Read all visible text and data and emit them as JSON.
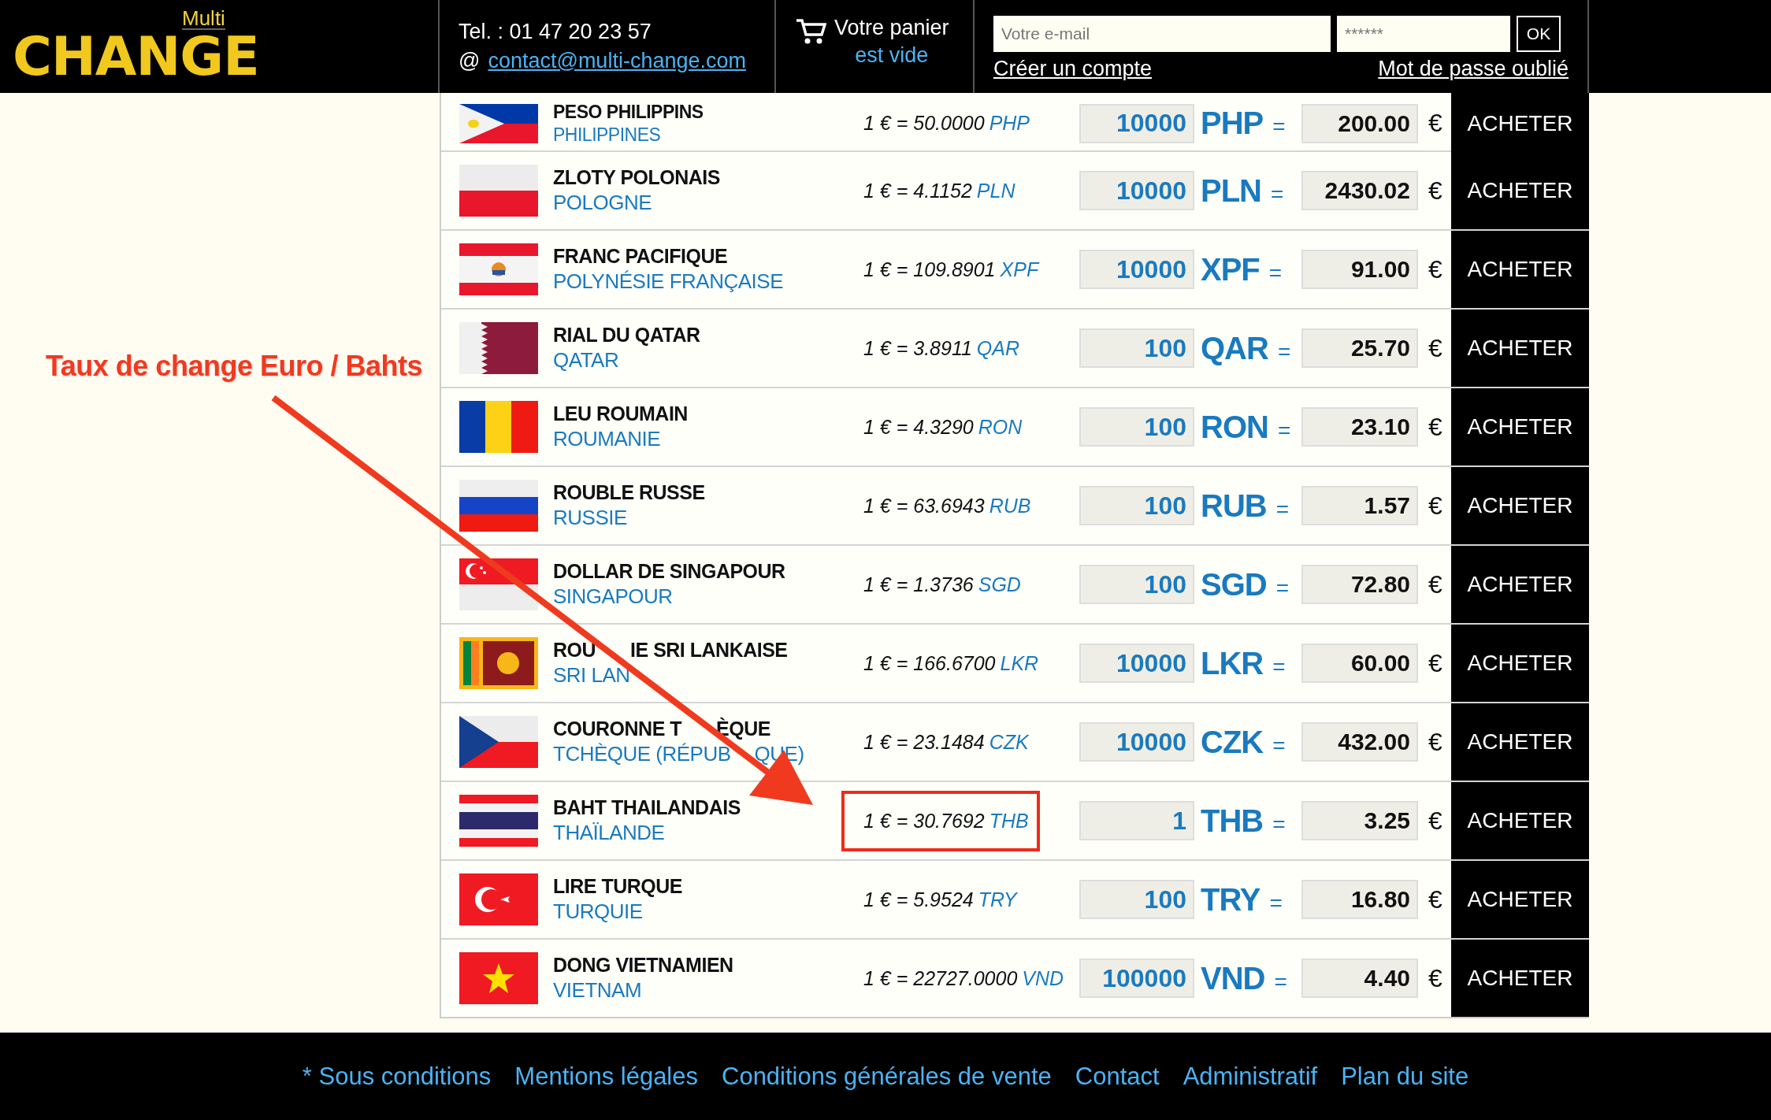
{
  "header": {
    "logo": {
      "small": "Multi",
      "big": "CHANGE"
    },
    "phone": "Tel. : 01 47 20 23 57",
    "at_sign": "@",
    "email_link": "contact@multi-change.com",
    "cart": {
      "title": "Votre panier",
      "status": "est vide"
    },
    "login": {
      "email_placeholder": "Votre e-mail",
      "password_placeholder": "******",
      "ok_button": "OK",
      "create_account": "Créer un compte",
      "forgot_password": "Mot de passe oublié"
    }
  },
  "annotation": {
    "label": "Taux de change Euro / Bahts"
  },
  "rates": [
    {
      "currency": [
        "PESO PHILIPPINS"
      ],
      "country": [
        "PHILIPPINES"
      ],
      "rate": "1 € = 50.0000",
      "rate_code": "PHP",
      "amount": "10000",
      "code": "PHP",
      "sign": "=",
      "price": "200.00",
      "euro": "€",
      "button": "ACHETER",
      "highlighted": false
    },
    {
      "currency": [
        "ZLOTY POLONAIS"
      ],
      "country": [
        "POLOGNE"
      ],
      "rate": "1 € = 4.1152",
      "rate_code": "PLN",
      "amount": "10000",
      "code": "PLN",
      "sign": "=",
      "price": "2430.02",
      "euro": "€",
      "button": "ACHETER",
      "highlighted": false
    },
    {
      "currency": [
        "FRANC PACIFIQUE"
      ],
      "country": [
        "POLYNÉSIE FRANÇAISE"
      ],
      "rate": "1 € = 109.8901",
      "rate_code": "XPF",
      "amount": "10000",
      "code": "XPF",
      "sign": "=",
      "price": "91.00",
      "euro": "€",
      "button": "ACHETER",
      "highlighted": false
    },
    {
      "currency": [
        "RIAL DU QATAR"
      ],
      "country": [
        "QATAR"
      ],
      "rate": "1 € = 3.8911",
      "rate_code": "QAR",
      "amount": "100",
      "code": "QAR",
      "sign": "=",
      "price": "25.70",
      "euro": "€",
      "button": "ACHETER",
      "highlighted": false
    },
    {
      "currency": [
        "LEU ROUMAIN"
      ],
      "country": [
        "ROUMANIE"
      ],
      "rate": "1 € = 4.3290",
      "rate_code": "RON",
      "amount": "100",
      "code": "RON",
      "sign": "=",
      "price": "23.10",
      "euro": "€",
      "button": "ACHETER",
      "highlighted": false
    },
    {
      "currency": [
        "ROUBLE RUSSE"
      ],
      "country": [
        "RUSSIE"
      ],
      "rate": "1 € = 63.6943",
      "rate_code": "RUB",
      "amount": "100",
      "code": "RUB",
      "sign": "=",
      "price": "1.57",
      "euro": "€",
      "button": "ACHETER",
      "highlighted": false
    },
    {
      "currency": [
        "DOLLAR DE SINGAPOUR"
      ],
      "country": [
        "SINGAPOUR"
      ],
      "rate": "1 € = 1.3736",
      "rate_code": "SGD",
      "amount": "100",
      "code": "SGD",
      "sign": "=",
      "price": "72.80",
      "euro": "€",
      "button": "ACHETER",
      "highlighted": false
    },
    {
      "currency": [
        "ROU",
        "IE SRI LANKAISE"
      ],
      "country": [
        "SRI LAN"
      ],
      "rate": "1 € = 166.6700",
      "rate_code": "LKR",
      "amount": "10000",
      "code": "LKR",
      "sign": "=",
      "price": "60.00",
      "euro": "€",
      "button": "ACHETER",
      "highlighted": false
    },
    {
      "currency": [
        "COURONNE T",
        "ÈQUE"
      ],
      "country": [
        "TCHÈQUE (RÉPUB",
        "QUE)"
      ],
      "rate": "1 € = 23.1484",
      "rate_code": "CZK",
      "amount": "10000",
      "code": "CZK",
      "sign": "=",
      "price": "432.00",
      "euro": "€",
      "button": "ACHETER",
      "highlighted": false
    },
    {
      "currency": [
        "BAHT THAILANDAIS"
      ],
      "country": [
        "THAÏLANDE"
      ],
      "rate": "1 € = 30.7692",
      "rate_code": "THB",
      "amount": "1",
      "code": "THB",
      "sign": "=",
      "price": "3.25",
      "euro": "€",
      "button": "ACHETER",
      "highlighted": true
    },
    {
      "currency": [
        "LIRE TURQUE"
      ],
      "country": [
        "TURQUIE"
      ],
      "rate": "1 € = 5.9524",
      "rate_code": "TRY",
      "amount": "100",
      "code": "TRY",
      "sign": "=",
      "price": "16.80",
      "euro": "€",
      "button": "ACHETER",
      "highlighted": false
    },
    {
      "currency": [
        "DONG VIETNAMIEN"
      ],
      "country": [
        "VIETNAM"
      ],
      "rate": "1 € = 22727.0000",
      "rate_code": "VND",
      "amount": "100000",
      "code": "VND",
      "sign": "=",
      "price": "4.40",
      "euro": "€",
      "button": "ACHETER",
      "highlighted": false
    }
  ],
  "footer": {
    "links": [
      "* Sous conditions",
      "Mentions légales",
      "Conditions générales de vente",
      "Contact",
      "Administratif",
      "Plan du site"
    ]
  }
}
